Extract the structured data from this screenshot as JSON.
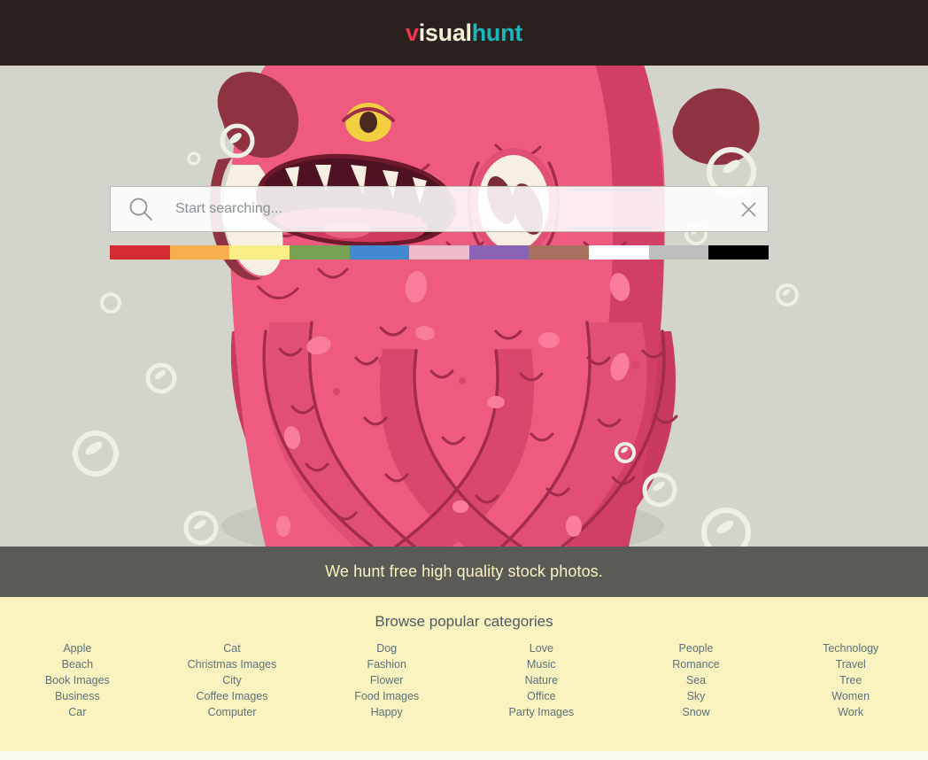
{
  "header": {
    "logo_part1": "v",
    "logo_part2": "isual",
    "logo_part3": "hunt",
    "logo_full": "visualhunt",
    "background_color": "#2a211f",
    "color_v": "#f6334f",
    "color_isual": "#f7f1da",
    "color_hunt": "#18b6bd"
  },
  "hero": {
    "background_color": "#d3d4cc",
    "illustration": "pink-monster-octopus",
    "bubbles": 12
  },
  "search": {
    "placeholder": "Start searching...",
    "value": "",
    "search_icon": "magnifier-icon",
    "clear_icon": "close-x-icon",
    "colors": [
      {
        "name": "red",
        "hex": "#d42b34"
      },
      {
        "name": "orange",
        "hex": "#f9af4e"
      },
      {
        "name": "yellow",
        "hex": "#f9ee85"
      },
      {
        "name": "green",
        "hex": "#76a152"
      },
      {
        "name": "blue",
        "hex": "#4389d1"
      },
      {
        "name": "pink",
        "hex": "#efbcca"
      },
      {
        "name": "purple",
        "hex": "#8a63b5"
      },
      {
        "name": "brown",
        "hex": "#a8715f"
      },
      {
        "name": "white",
        "hex": "#ffffff"
      },
      {
        "name": "gray",
        "hex": "#bcbdbd"
      },
      {
        "name": "black",
        "hex": "#000000"
      }
    ]
  },
  "tagline": {
    "text": "We hunt free high quality stock photos.",
    "background_color": "#555350",
    "text_color": "#faf3c3"
  },
  "categories": {
    "title": "Browse popular categories",
    "background_color": "#faf3c0",
    "link_color": "#5b7179",
    "columns": [
      {
        "items": [
          "Apple",
          "Beach",
          "Book Images",
          "Business",
          "Car"
        ]
      },
      {
        "items": [
          "Cat",
          "Christmas Images",
          "City",
          "Coffee Images",
          "Computer"
        ]
      },
      {
        "items": [
          "Dog",
          "Fashion",
          "Flower",
          "Food Images",
          "Happy"
        ]
      },
      {
        "items": [
          "Love",
          "Music",
          "Nature",
          "Office",
          "Party Images"
        ]
      },
      {
        "items": [
          "People",
          "Romance",
          "Sea",
          "Sky",
          "Snow"
        ]
      },
      {
        "items": [
          "Technology",
          "Travel",
          "Tree",
          "Women",
          "Work"
        ]
      }
    ]
  }
}
